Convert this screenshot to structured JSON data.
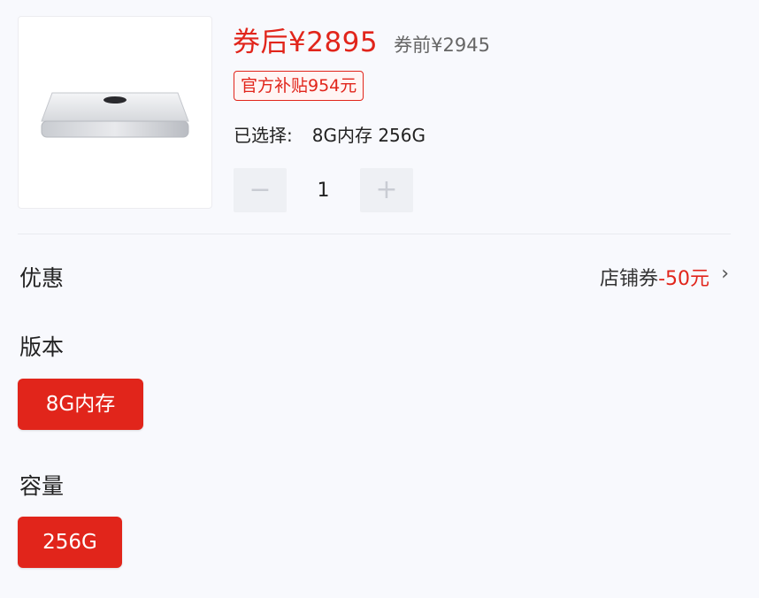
{
  "product": {
    "image_icon": "mac-mini-icon",
    "price_after_label": "券后¥2895",
    "price_before_label": "券前¥2945",
    "subsidy_badge": "官方补贴954元",
    "selected_label": "已选择:",
    "selected_value": "8G内存 256G",
    "quantity": "1",
    "minus_symbol": "−",
    "plus_symbol": "+"
  },
  "promotion": {
    "label": "优惠",
    "coupon_prefix": "店铺券",
    "coupon_amount": "-50元",
    "chevron": "›"
  },
  "version": {
    "label": "版本",
    "options": [
      "8G内存"
    ],
    "selected": "8G内存"
  },
  "capacity": {
    "label": "容量",
    "options": [
      "256G"
    ],
    "selected": "256G"
  },
  "colors": {
    "accent": "#e1251b",
    "background": "#f8f9fd"
  }
}
